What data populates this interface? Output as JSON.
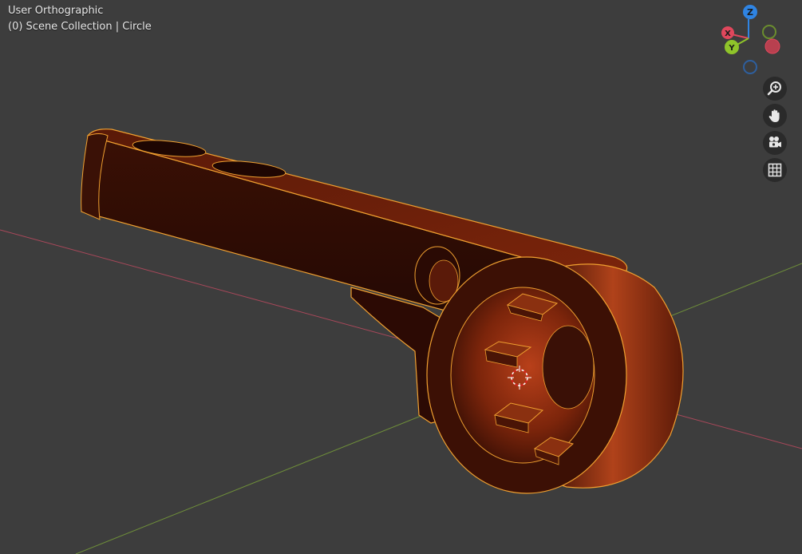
{
  "viewport": {
    "view_name": "User Orthographic",
    "collection_info": "(0) Scene Collection | Circle"
  },
  "gizmo": {
    "axes": {
      "x": "X",
      "y": "Y",
      "z": "Z"
    },
    "colors": {
      "x": "#e0475c",
      "y": "#8fc42a",
      "z": "#2f84e3",
      "x_neg": "#b8404f",
      "y_neg": "#6b8d2e",
      "z_neg": "#2e5f9e"
    }
  },
  "navigation": {
    "icons": [
      "zoom-icon",
      "hand-pan-icon",
      "camera-icon",
      "grid-icon"
    ]
  },
  "colors": {
    "background": "#3d3d3d",
    "selection_outline": "#f0a030",
    "x_axis_line": "#a8485a",
    "y_axis_line": "#6e8e3a",
    "model_dark": "#2a0b04",
    "model_mid": "#5b1a08",
    "model_light": "#a83a15"
  }
}
